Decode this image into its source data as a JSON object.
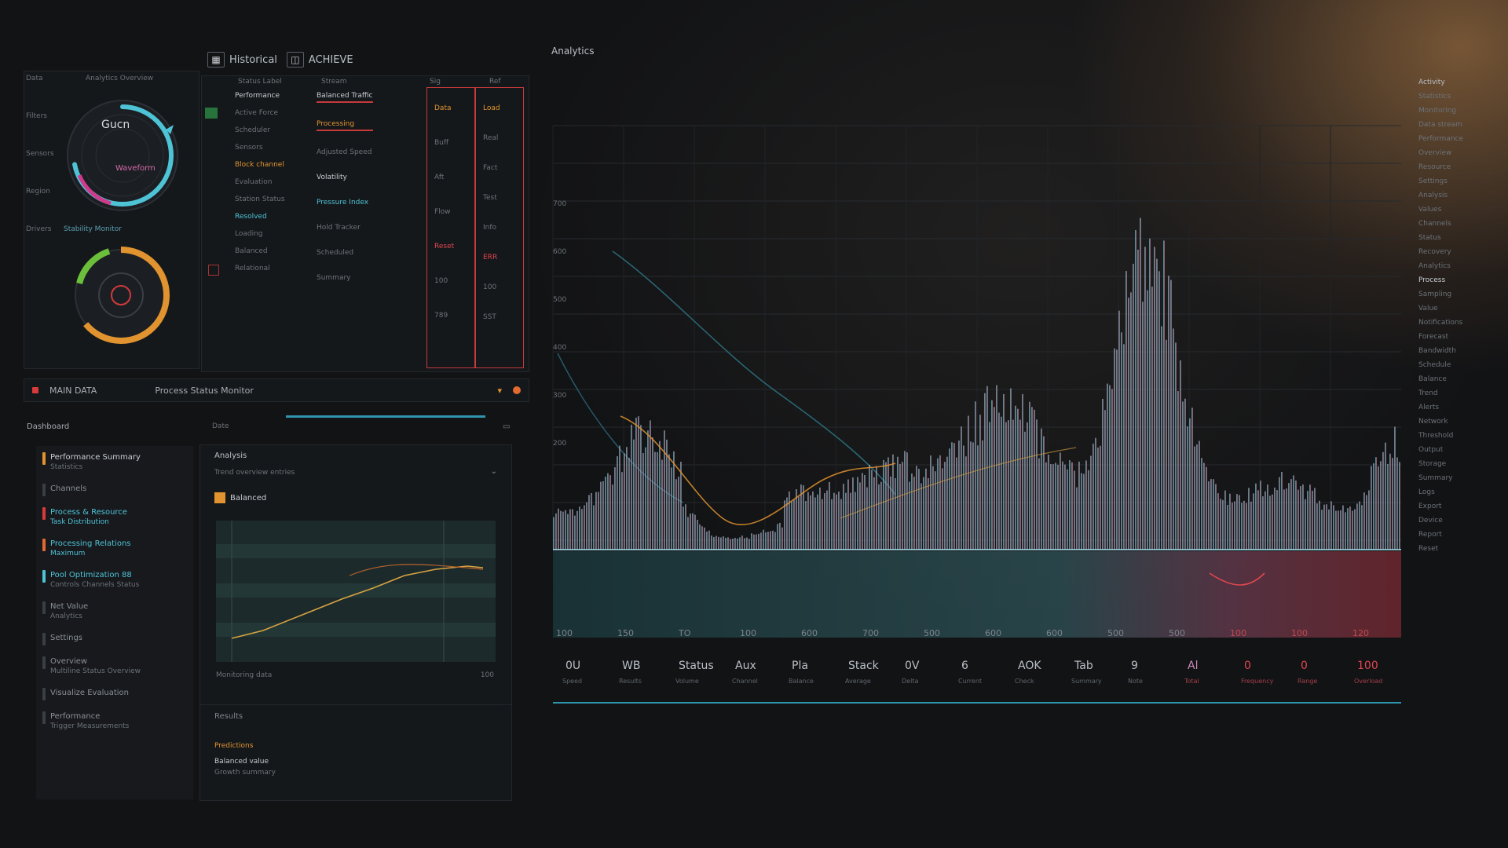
{
  "toolbar": {
    "item1_icon": "grid-icon",
    "item1_label": "Historical",
    "item2_icon": "split-icon",
    "item2_label": "ACHIEVE"
  },
  "gauge_panel": {
    "title": "Analytics Overview",
    "side_labels": [
      "Data",
      "Filters",
      "Sensors",
      "Region",
      "Drivers"
    ],
    "gauge1": {
      "center_label": "Gucn",
      "sub_label": "Waveform",
      "percent": 0.72,
      "accent": "#4fc3d6",
      "accent2": "#d03a8c"
    },
    "gauge2": {
      "caption": "Stability Monitor",
      "percent": 0.64,
      "accent": "#e0932f",
      "accent2": "#6bbf3a"
    }
  },
  "table": {
    "headers": [
      "Status Label",
      "Stream",
      "Sig",
      "Ref"
    ],
    "col1": [
      "Performance",
      "Active Force",
      "Scheduler",
      "Sensors",
      "Block channel",
      "Evaluation",
      "Station Status",
      "Resolved",
      "Loading",
      "Balanced",
      "Relational"
    ],
    "col2": [
      "Balanced Traffic",
      "Processing",
      "Adjusted Speed",
      "Volatility",
      "Pressure Index",
      "Hold Tracker",
      "Scheduled",
      "Summary"
    ],
    "col3": [
      "Data",
      "Buff",
      "Aft",
      "Flow",
      "Reset",
      "100",
      "789"
    ],
    "col4": [
      "Load",
      "Real",
      "Fact",
      "Test",
      "Info",
      "ERR",
      "100",
      "SST"
    ]
  },
  "status_bar": {
    "left": "MAIN DATA",
    "middle": "Process Status Monitor"
  },
  "list_panel": {
    "title": "Dashboard",
    "tab": "Date",
    "items": [
      {
        "title": "Performance Summary",
        "sub": "Statistics",
        "color": "#e0932f"
      },
      {
        "title": "Channels",
        "sub": "",
        "color": "#3a3f45"
      },
      {
        "title": "Process & Resource",
        "sub": "Task Distribution",
        "color": "#d63a3a"
      },
      {
        "title": "Processing Relations",
        "sub": "Maximum",
        "color": "#e06a2f"
      },
      {
        "title": "Pool Optimization 88",
        "sub": "Controls Channels Status",
        "color": "#4fc3d6"
      },
      {
        "title": "Net Value",
        "sub": "Analytics",
        "color": "#3a3f45"
      },
      {
        "title": "Settings",
        "sub": "",
        "color": "#3a3f45"
      },
      {
        "title": "Overview",
        "sub": "Multiline Status Overview",
        "color": "#3a3f45"
      },
      {
        "title": "Visualize Evaluation",
        "sub": "",
        "color": "#3a3f45"
      },
      {
        "title": "Performance",
        "sub": "Trigger Measurements",
        "color": "#3a3f45"
      }
    ]
  },
  "mini_panel": {
    "title": "Analysis",
    "subtitle": "Trend overview entries",
    "chart_title": "Balanced",
    "footer": "Monitoring data",
    "footer_right": "100",
    "bottom_title": "Results",
    "bottom_lines": [
      "Predictions",
      "Balanced value",
      "Growth summary"
    ],
    "trend_color": "#d9a441"
  },
  "main_chart": {
    "title": "Analytics",
    "tick_row": [
      "100",
      "150",
      "TO",
      "100",
      "600",
      "700",
      "500",
      "600",
      "600",
      "500",
      "500",
      "100",
      "100",
      "120"
    ],
    "metrics": [
      {
        "value": "0U",
        "label": "Speed"
      },
      {
        "value": "WB",
        "label": "Results"
      },
      {
        "value": "Status",
        "label": "Volume"
      },
      {
        "value": "Aux",
        "label": "Channel"
      },
      {
        "value": "Pla",
        "label": "Balance"
      },
      {
        "value": "Stack",
        "label": "Average"
      },
      {
        "value": "0V",
        "label": "Delta"
      },
      {
        "value": "6",
        "label": "Current"
      },
      {
        "value": "AOK",
        "label": "Check"
      },
      {
        "value": "Tab",
        "label": "Summary"
      },
      {
        "value": "9",
        "label": "Note"
      },
      {
        "value": "Al",
        "label": "Total"
      },
      {
        "value": "0",
        "label": "Frequency"
      },
      {
        "value": "0",
        "label": "Range"
      },
      {
        "value": "100",
        "label": "Overload"
      }
    ],
    "y_ticks": [
      "700",
      "600",
      "500",
      "400",
      "300",
      "200"
    ],
    "colors": {
      "teal": "#4fc3d6",
      "pink": "#c98bb5",
      "red": "#e0474f",
      "orange": "#e0932f"
    }
  },
  "right_list": [
    "Activity",
    "Statistics",
    "Monitoring",
    "Data stream",
    "Performance",
    "Overview",
    "Resource",
    "Settings",
    "Analysis",
    "Values",
    "Channels",
    "Status",
    "Recovery",
    "Analytics",
    "Process",
    "Sampling",
    "Value",
    "Notifications",
    "Forecast",
    "Bandwidth",
    "Schedule",
    "Balance",
    "Trend",
    "Alerts",
    "Network",
    "Threshold",
    "Output",
    "Storage",
    "Summary",
    "Logs",
    "Export",
    "Device",
    "Report",
    "Reset"
  ]
}
